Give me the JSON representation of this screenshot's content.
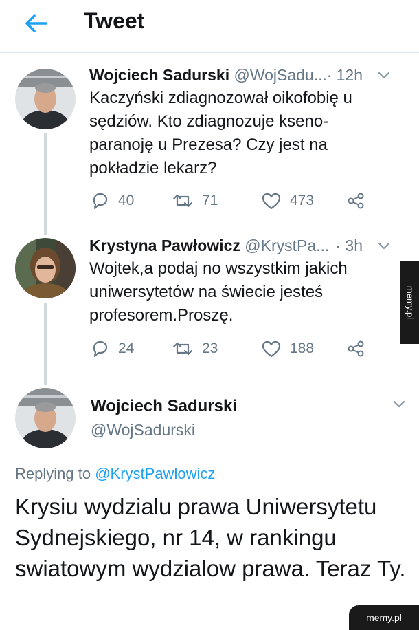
{
  "header": {
    "title": "Tweet",
    "back_icon": "arrow-left-icon",
    "accent": "#1da1f2"
  },
  "tweets": [
    {
      "name": "Wojciech Sadurski",
      "handle": "@WojSadu...",
      "time": "· 12h",
      "text": "Kaczyński zdiagnozował oikofobię u sędziów. Kto zdiagnozuje kseno-paranoję u Prezesa? Czy jest na pokładzie lekarz?",
      "replies": "40",
      "retweets": "71",
      "likes": "473"
    },
    {
      "name": "Krystyna Pawłowicz",
      "handle": "@KrystPa...",
      "time": "· 3h",
      "text": "Wojtek,a podaj no wszystkim jakich uniwersytetów na świecie jesteś profesorem.Proszę.",
      "replies": "24",
      "retweets": "23",
      "likes": "188"
    }
  ],
  "main_tweet": {
    "name": "Wojciech Sadurski",
    "handle": "@WojSadurski",
    "replying_prefix": "Replying to",
    "replying_to": "@KrystPawlowicz",
    "text": "Krysiu wydzialu prawa Uniwersytetu Sydnejskiego, nr 14, w rankingu swiatowym wydzialow prawa. Teraz Ty."
  },
  "watermarks": {
    "side": "memy.pl",
    "bottom": "memy.pl"
  }
}
